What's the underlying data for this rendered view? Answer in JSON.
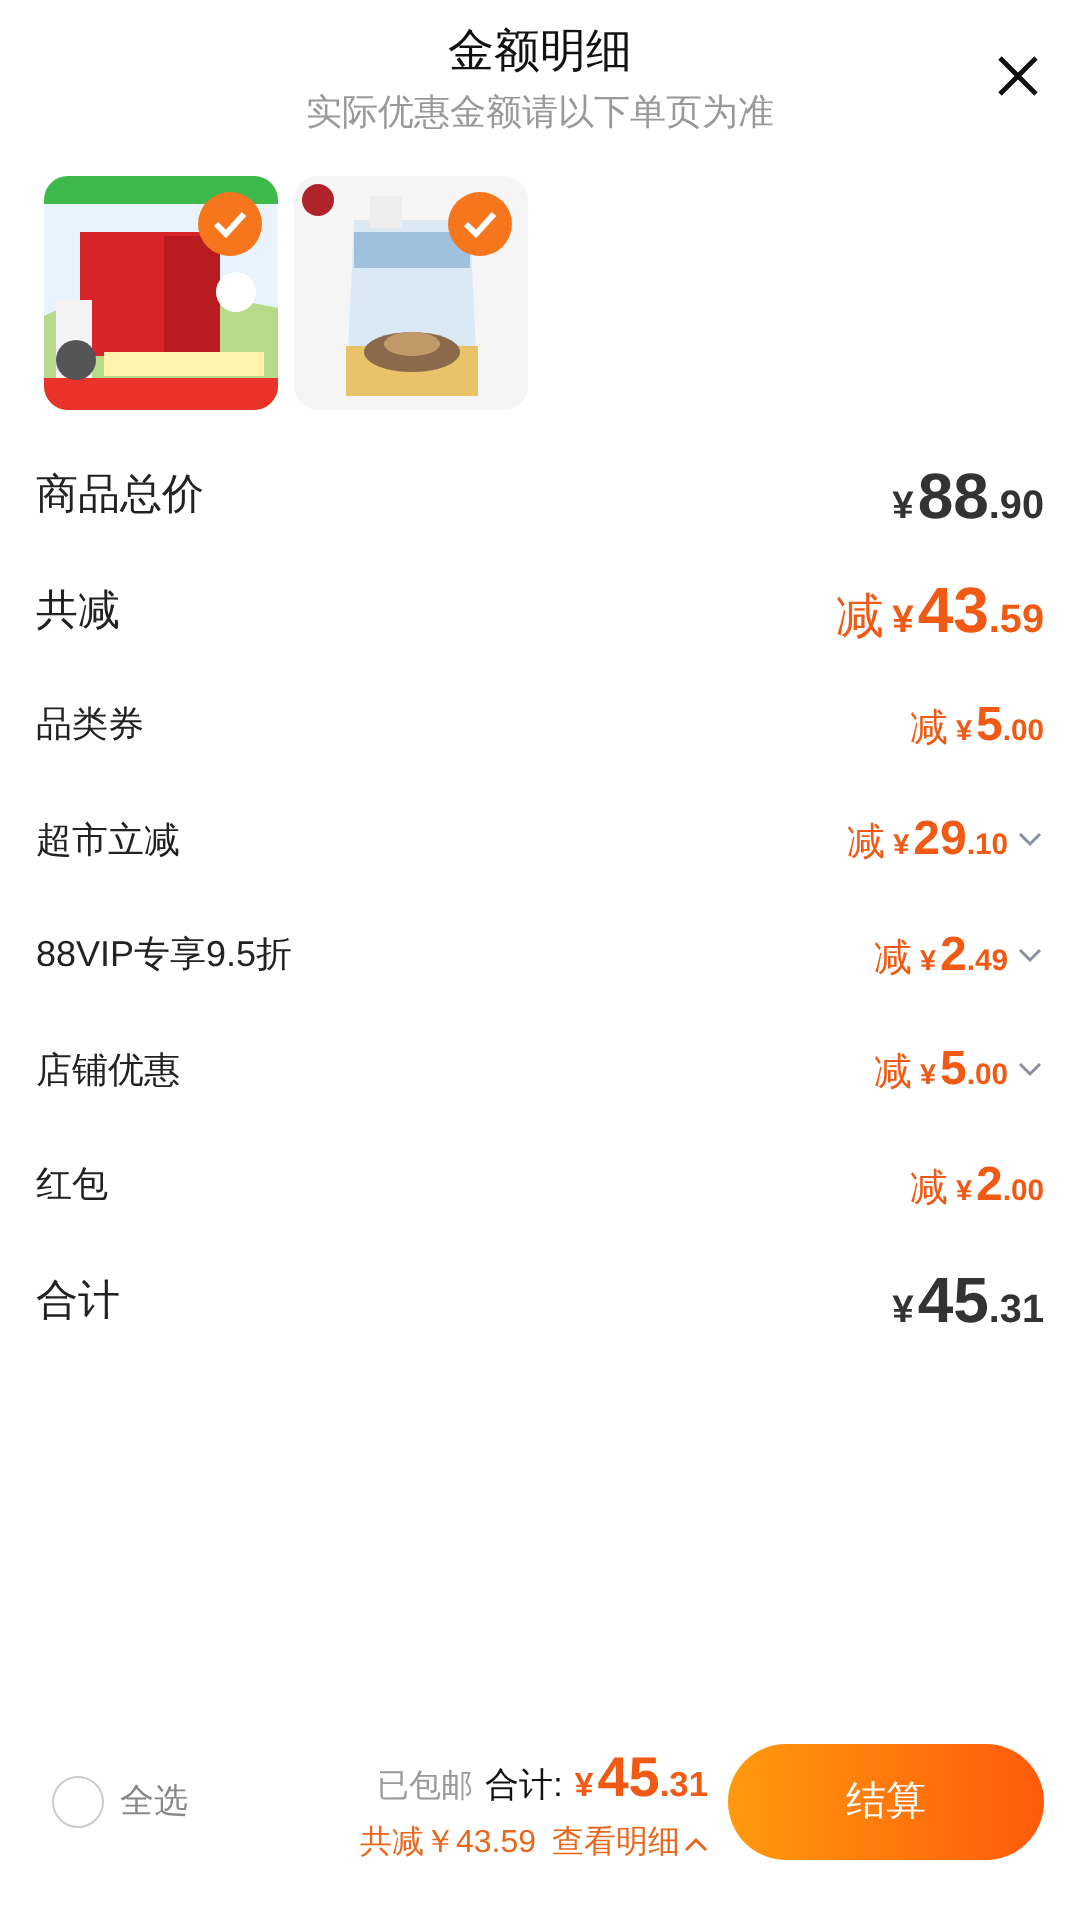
{
  "header": {
    "title": "金额明细",
    "subtitle": "实际优惠金额请以下单页为准"
  },
  "products": [
    {
      "kind": "picture",
      "selected": true
    },
    {
      "kind": "picture",
      "selected": true
    }
  ],
  "rows": [
    {
      "label": "商品总价",
      "kind": "summary",
      "currency": "¥",
      "whole": "88",
      "fraction": ".90",
      "expandable": false
    },
    {
      "label": "共减",
      "kind": "savings",
      "prefix": "减",
      "currency": "¥",
      "whole": "43",
      "fraction": ".59",
      "expandable": false
    },
    {
      "label": "品类券",
      "kind": "discount",
      "prefix": "减",
      "currency": "¥",
      "whole": "5",
      "fraction": ".00",
      "expandable": false
    },
    {
      "label": "超市立减",
      "kind": "discount",
      "prefix": "减",
      "currency": "¥",
      "whole": "29",
      "fraction": ".10",
      "expandable": true
    },
    {
      "label": "88VIP专享9.5折",
      "kind": "discount",
      "prefix": "减",
      "currency": "¥",
      "whole": "2",
      "fraction": ".49",
      "expandable": true
    },
    {
      "label": "店铺优惠",
      "kind": "discount",
      "prefix": "减",
      "currency": "¥",
      "whole": "5",
      "fraction": ".00",
      "expandable": true
    },
    {
      "label": "红包",
      "kind": "discount",
      "prefix": "减",
      "currency": "¥",
      "whole": "2",
      "fraction": ".00",
      "expandable": false
    },
    {
      "label": "合计",
      "kind": "summary",
      "currency": "¥",
      "whole": "45",
      "fraction": ".31",
      "expandable": false
    }
  ],
  "footer": {
    "select_all": {
      "label": "全选",
      "checked": false
    },
    "shipping": "已包邮",
    "total_label": "合计:",
    "total": {
      "currency": "¥",
      "whole": "45",
      "fraction": ".31"
    },
    "savings": "共减￥43.59",
    "details_link": "查看明细",
    "checkout": "结算"
  }
}
